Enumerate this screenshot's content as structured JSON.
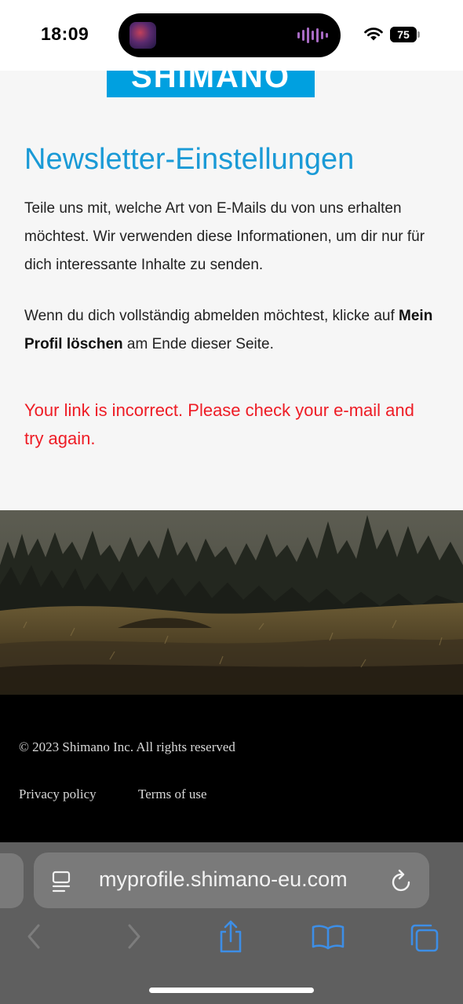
{
  "status_bar": {
    "time": "18:09",
    "battery": "75",
    "battery_level": 0.75
  },
  "logo": {
    "text": "SHIMANO"
  },
  "content": {
    "title": "Newsletter-Einstellungen",
    "intro": "Teile uns mit, welche Art von E-Mails du von uns erhalten möchtest. Wir verwenden diese Informationen, um dir nur für dich interessante Inhalte zu senden.",
    "unsubscribe_prefix": "Wenn du dich vollständig abmelden möchtest, klicke auf",
    "unsubscribe_bold": "Mein Profil löschen",
    "unsubscribe_suffix": "am Ende dieser Seite.",
    "error": "Your link is incorrect. Please check your e-mail and try again."
  },
  "footer": {
    "copyright": "© 2023 Shimano Inc. All rights reserved",
    "privacy": "Privacy policy",
    "terms": "Terms of use"
  },
  "browser": {
    "url": "myprofile.shimano-eu.com",
    "icons": [
      "page-menu-icon",
      "reload-icon",
      "back-icon",
      "forward-icon",
      "share-icon",
      "bookmarks-icon",
      "tabs-icon"
    ]
  },
  "colors": {
    "title": "#1a9ad6",
    "error": "#ee1c25",
    "logo_bg": "#00a0e0",
    "tint": "#3d8ee6"
  }
}
